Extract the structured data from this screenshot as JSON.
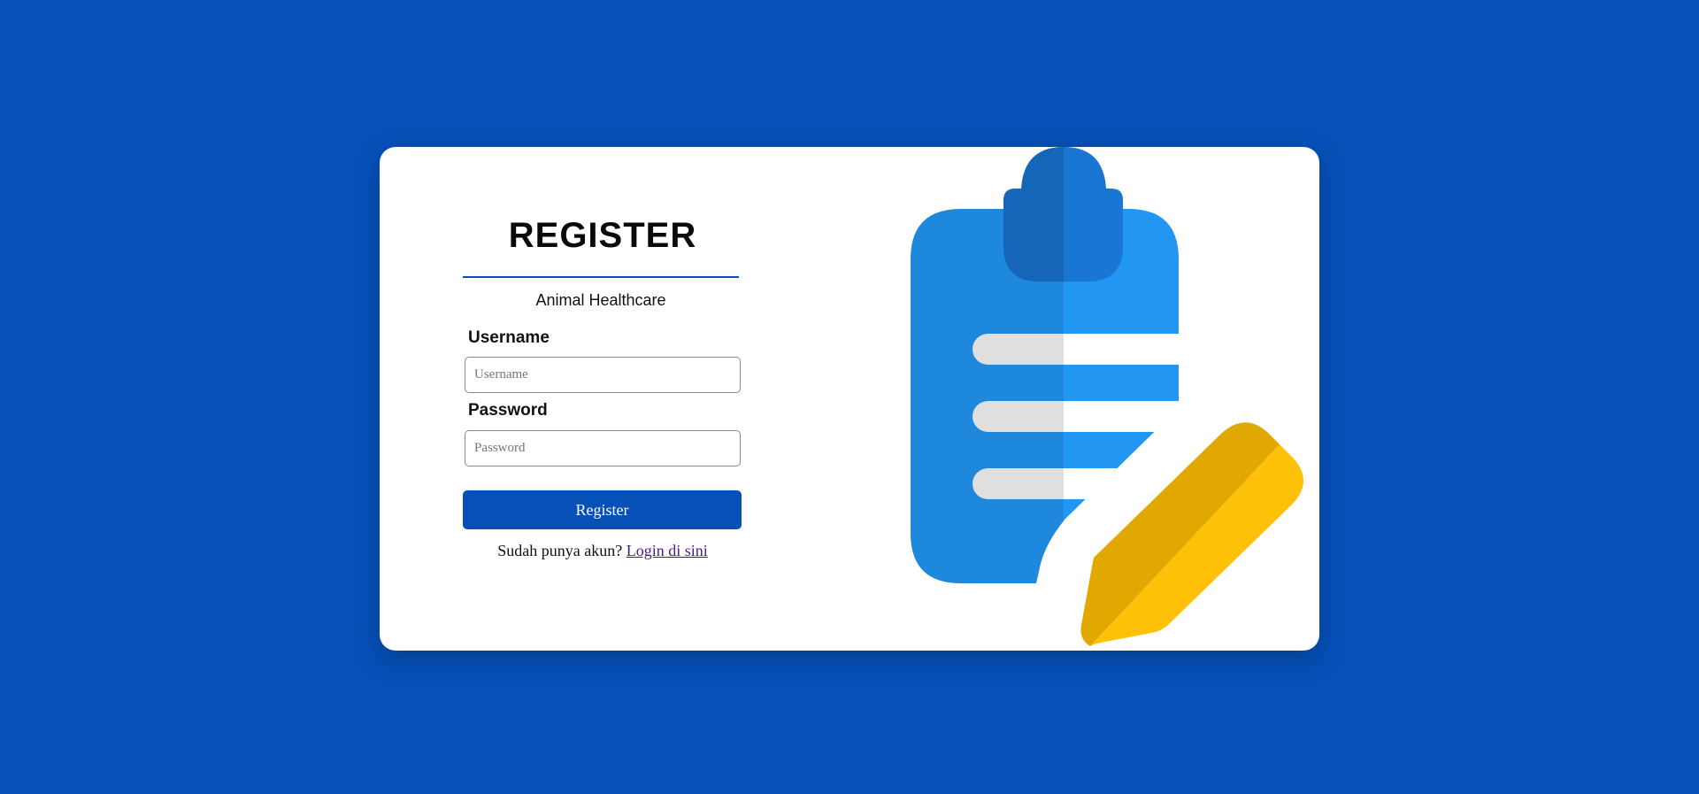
{
  "page": {
    "background_color": "#0650b8"
  },
  "register_form": {
    "title": "REGISTER",
    "subtitle": "Animal Healthcare",
    "username_label": "Username",
    "username_placeholder": "Username",
    "password_label": "Password",
    "password_placeholder": "Password",
    "submit_label": "Register",
    "login_prompt": "Sudah punya akun?",
    "login_link": "Login di sini"
  },
  "illustration": {
    "icons": [
      "clipboard-icon",
      "pencil-icon"
    ],
    "colors": {
      "clipboard_light": "#2196f3",
      "clipboard_dark": "#1e88dc",
      "pencil_light": "#ffc107",
      "pencil_dark": "#e0a800",
      "lines_light": "#ffffff",
      "lines_dark": "#dfdfdf"
    }
  }
}
